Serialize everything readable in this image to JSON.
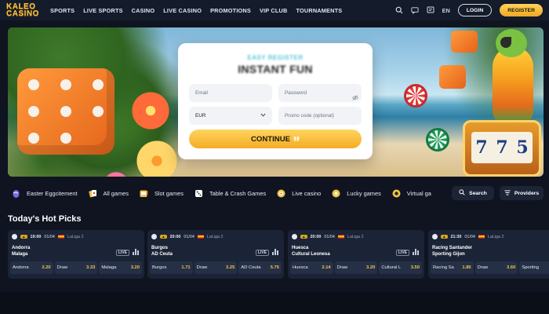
{
  "header": {
    "logo_line1": "KALEO",
    "logo_line2": "CASINO",
    "nav": [
      "SPORTS",
      "LIVE SPORTS",
      "CASINO",
      "LIVE CASINO",
      "PROMOTIONS",
      "VIP CLUB",
      "TOURNAMENTS"
    ],
    "lang": "EN",
    "login": "LOGIN",
    "register": "REGISTER"
  },
  "banner": {
    "subtitle": "EASY REGISTER",
    "title": "INSTANT FUN",
    "email_placeholder": "Email",
    "password_placeholder": "Password",
    "currency": "EUR",
    "promo_placeholder": "Promo code (optional)",
    "continue": "CONTINUE",
    "slot_digits": [
      "7",
      "7",
      "5"
    ]
  },
  "categories": [
    "Easter Eggcitement",
    "All games",
    "Slot games",
    "Table & Crash Games",
    "Live casino",
    "Lucky games",
    "Virtual ga"
  ],
  "search_label": "Search",
  "providers_label": "Providers",
  "hot_title": "Today's Hot Picks",
  "matches": [
    {
      "time": "19:00",
      "date": "01/04",
      "league": "LaLiga 2",
      "home": "Andorra",
      "away": "Malaga",
      "live": "LIVE",
      "odds": [
        {
          "label": "Andorra",
          "value": "2.20"
        },
        {
          "label": "Draw",
          "value": "3.33"
        },
        {
          "label": "Malaga",
          "value": "3.20"
        }
      ]
    },
    {
      "time": "20:00",
      "date": "01/04",
      "league": "LaLiga 2",
      "home": "Burgos",
      "away": "AD Ceuta",
      "live": "LIVE",
      "odds": [
        {
          "label": "Burgos",
          "value": "1.71"
        },
        {
          "label": "Draw",
          "value": "3.25"
        },
        {
          "label": "AD Ceuta",
          "value": "5.75"
        }
      ]
    },
    {
      "time": "20:00",
      "date": "01/04",
      "league": "LaLiga 2",
      "home": "Huesca",
      "away": "Cultural Leonesa",
      "live": "LIVE",
      "odds": [
        {
          "label": "Huesca",
          "value": "2.14"
        },
        {
          "label": "Draw",
          "value": "3.20"
        },
        {
          "label": "Cultural L",
          "value": "3.50"
        }
      ]
    },
    {
      "time": "21:30",
      "date": "01/04",
      "league": "LaLiga 2",
      "home": "Racing Santander",
      "away": "Sporting Gijon",
      "live": "",
      "odds": [
        {
          "label": "Racing Sa",
          "value": "1.85"
        },
        {
          "label": "Draw",
          "value": "3.60"
        },
        {
          "label": "Sporting",
          "value": ""
        }
      ]
    }
  ],
  "colors": {
    "accent": "#f5b52e",
    "background": "#0f1420",
    "card": "#1b2436",
    "teal": "#58c7d8"
  },
  "icons": {
    "search": "search-icon",
    "chat": "chat-icon",
    "message": "message-icon",
    "eye": "eye-icon",
    "filter": "filter-icon"
  }
}
